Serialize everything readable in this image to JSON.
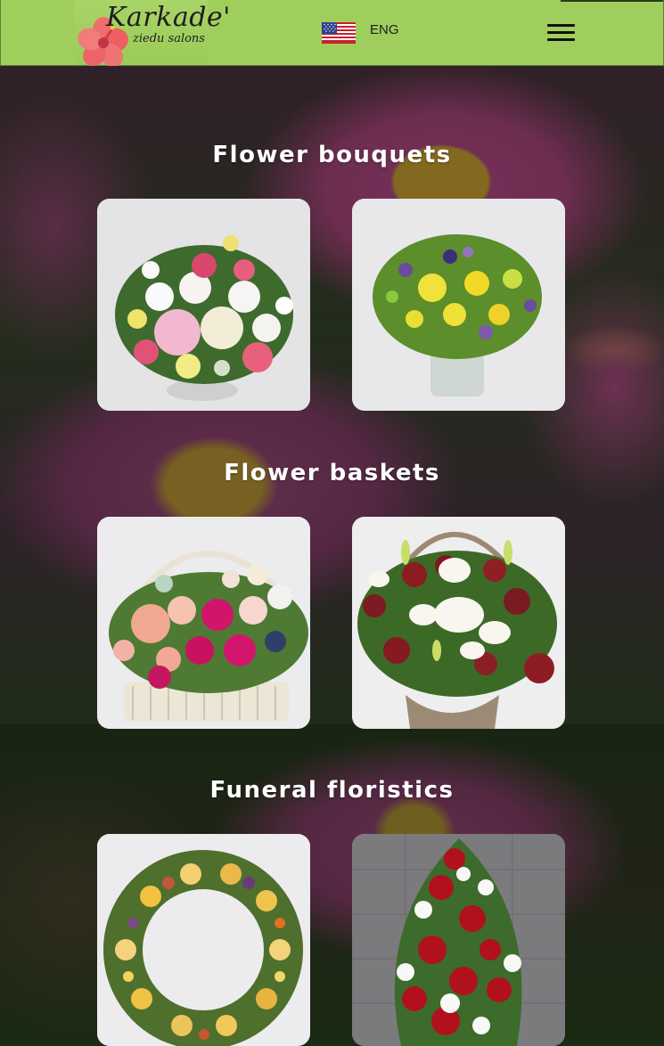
{
  "header": {
    "logo": {
      "title": "Karkade'",
      "subtitle": "ziedu salons"
    },
    "language": {
      "label": "ENG",
      "flag": "us-flag-icon"
    },
    "menu_icon": "hamburger-menu-icon"
  },
  "colors": {
    "header_bg": "#9fce5c",
    "title_text": "#ffffff"
  },
  "sections": [
    {
      "title": "Flower bouquets",
      "cards": [
        "bouquet-1",
        "bouquet-2"
      ]
    },
    {
      "title": "Flower baskets",
      "cards": [
        "basket-1",
        "basket-2"
      ]
    },
    {
      "title": "Funeral floristics",
      "cards": [
        "funeral-wreath",
        "funeral-arrangement"
      ]
    }
  ]
}
